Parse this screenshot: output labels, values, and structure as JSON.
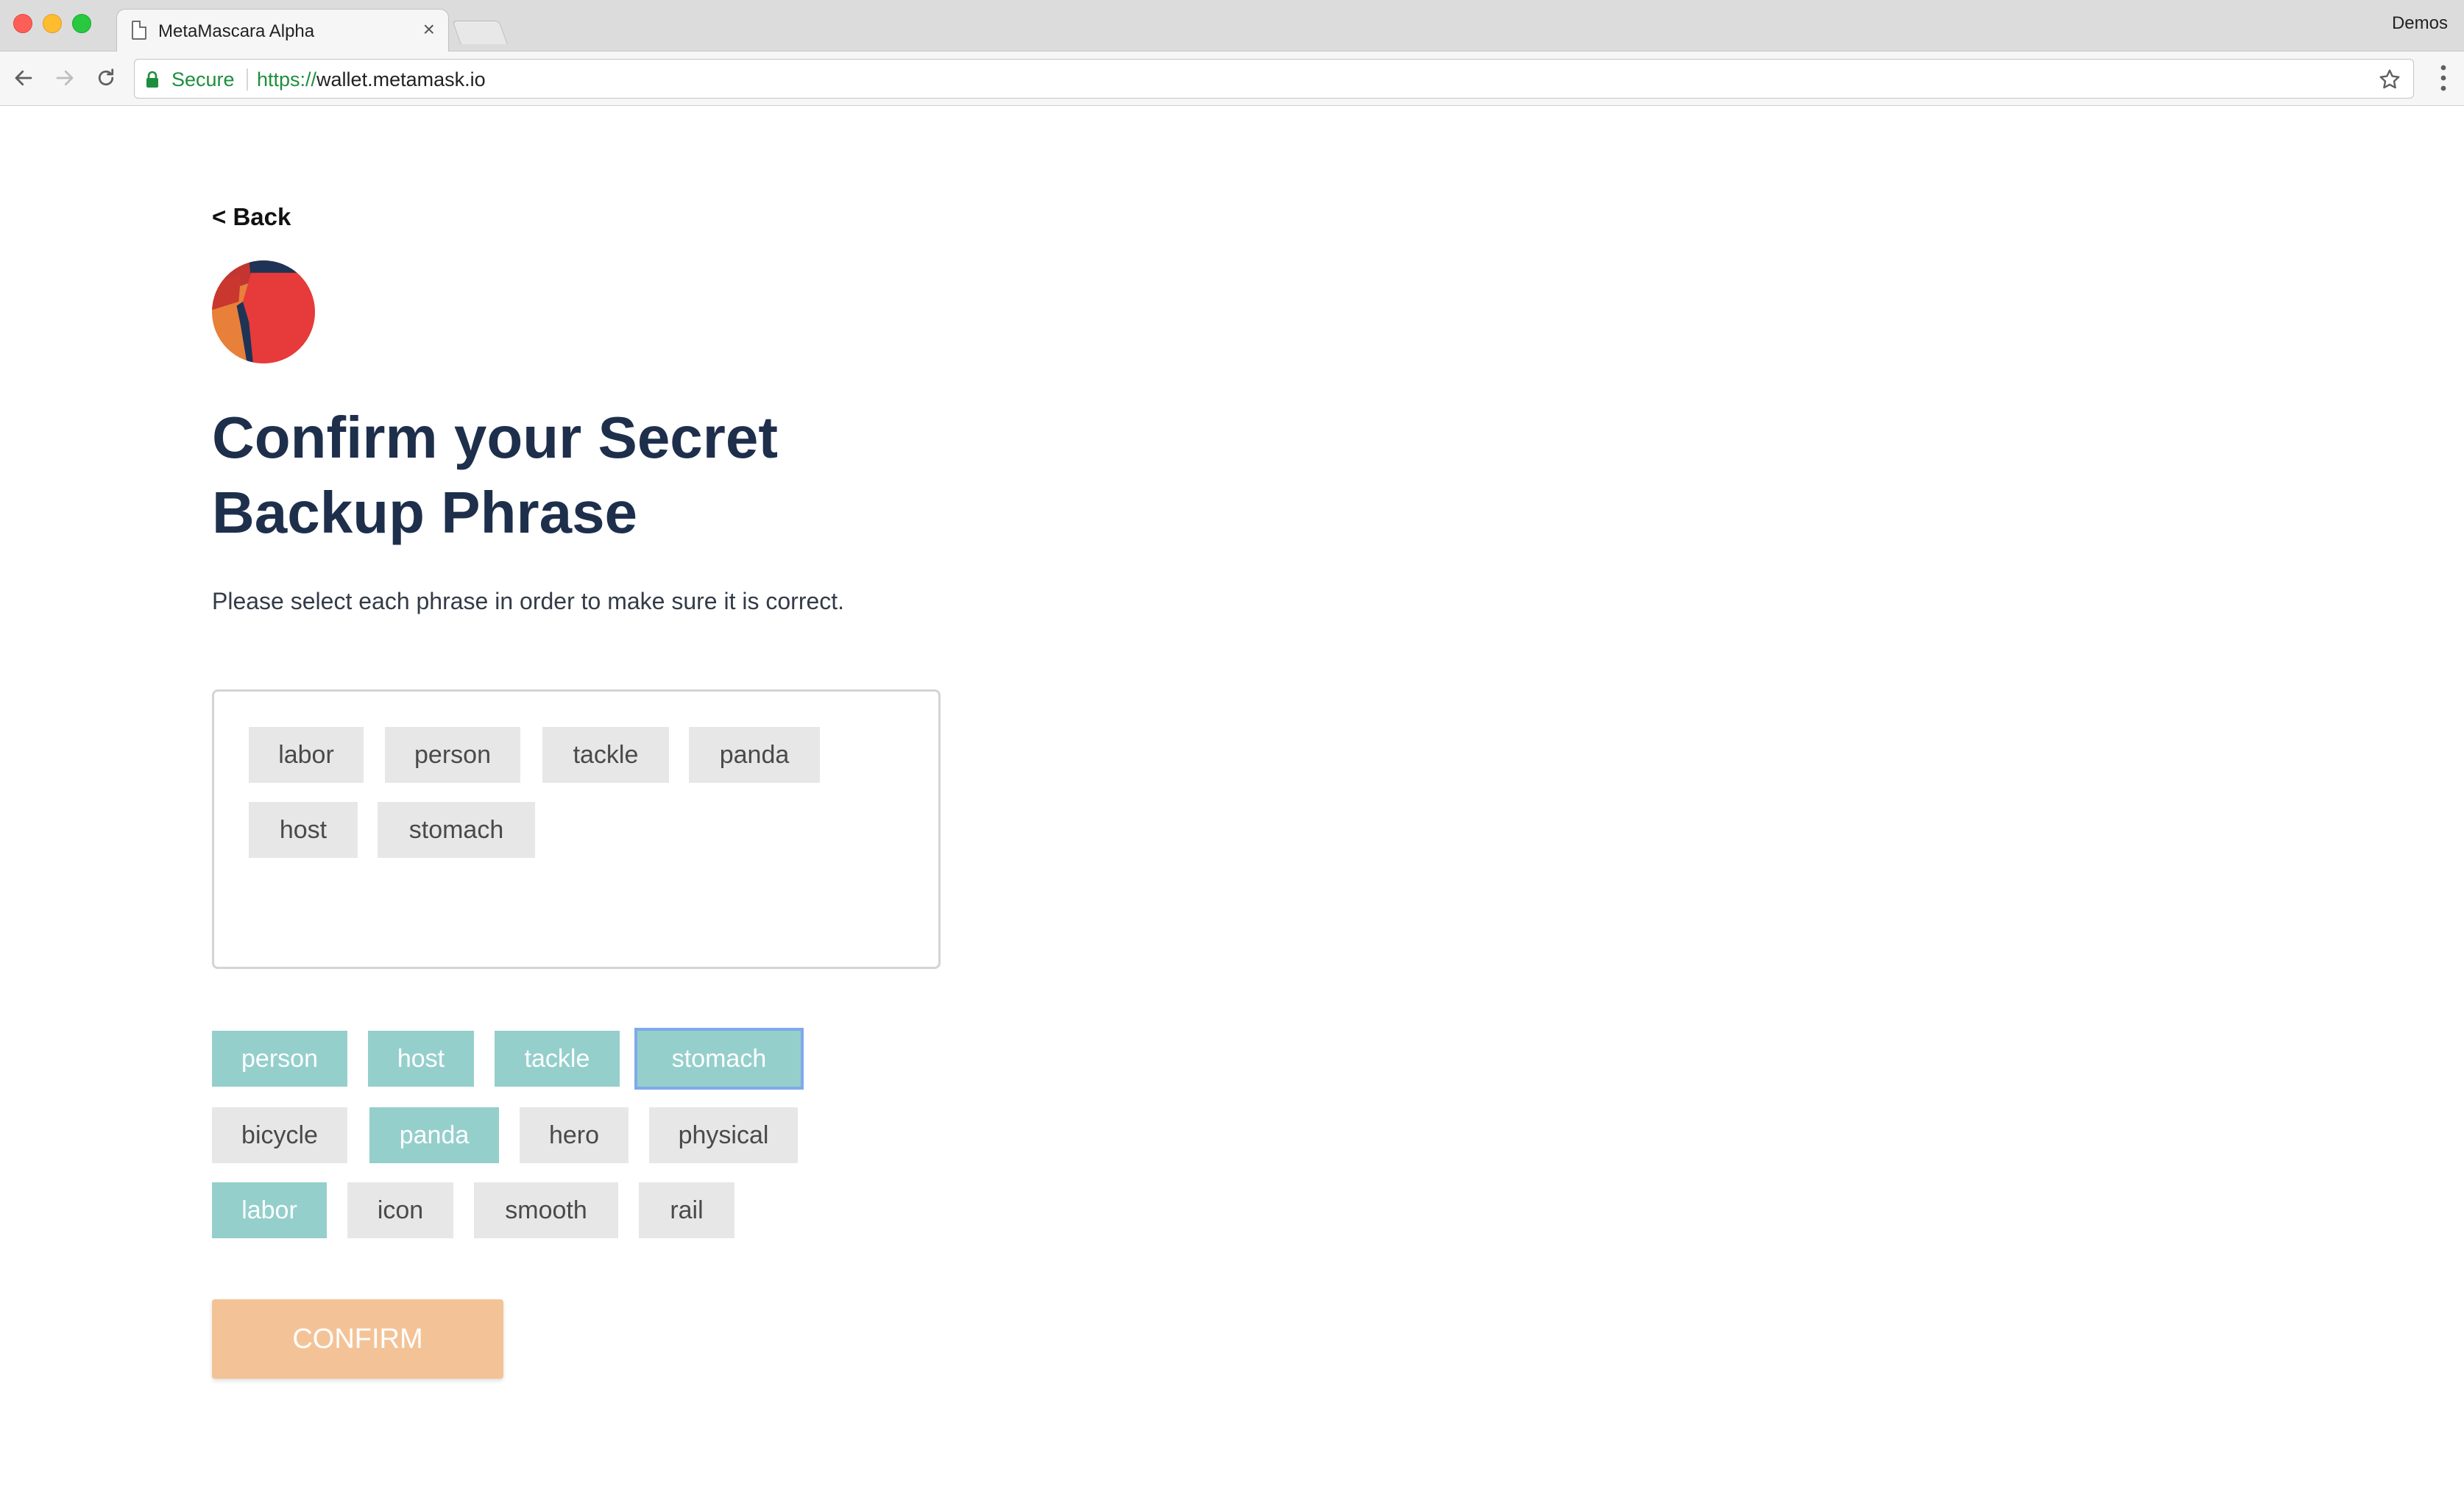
{
  "browser": {
    "tab_title": "MetaMascara Alpha",
    "tab_close": "×",
    "profile_name": "Demos",
    "secure_label": "Secure",
    "url_scheme": "https://",
    "url_host": "wallet.metamask.io"
  },
  "page": {
    "back_label": "< Back",
    "title_line1": "Confirm your Secret",
    "title_line2": "Backup Phrase",
    "description": "Please select each phrase in order to make sure it is correct.",
    "selected_words": [
      "labor",
      "person",
      "tackle",
      "panda",
      "host",
      "stomach"
    ],
    "word_choices": [
      {
        "word": "person",
        "selected": true
      },
      {
        "word": "host",
        "selected": true
      },
      {
        "word": "tackle",
        "selected": true
      },
      {
        "word": "stomach",
        "selected": true,
        "focused": true
      },
      {
        "word": "bicycle",
        "selected": false
      },
      {
        "word": "panda",
        "selected": true
      },
      {
        "word": "hero",
        "selected": false
      },
      {
        "word": "physical",
        "selected": false
      },
      {
        "word": "labor",
        "selected": true
      },
      {
        "word": "icon",
        "selected": false
      },
      {
        "word": "smooth",
        "selected": false
      },
      {
        "word": "rail",
        "selected": false
      }
    ],
    "confirm_label": "CONFIRM"
  },
  "colors": {
    "title": "#1e2f4c",
    "word_selected_bg": "#94cfcc",
    "word_unselected_bg": "#e7e7e7",
    "confirm_bg": "#f3c397",
    "secure_green": "#1e8e3e"
  },
  "icons": {
    "tab": "document-icon",
    "back": "arrow-left-icon",
    "forward": "arrow-right-icon",
    "reload": "reload-icon",
    "lock": "lock-icon",
    "bookmark": "star-icon",
    "menu": "kebab-menu-icon"
  }
}
